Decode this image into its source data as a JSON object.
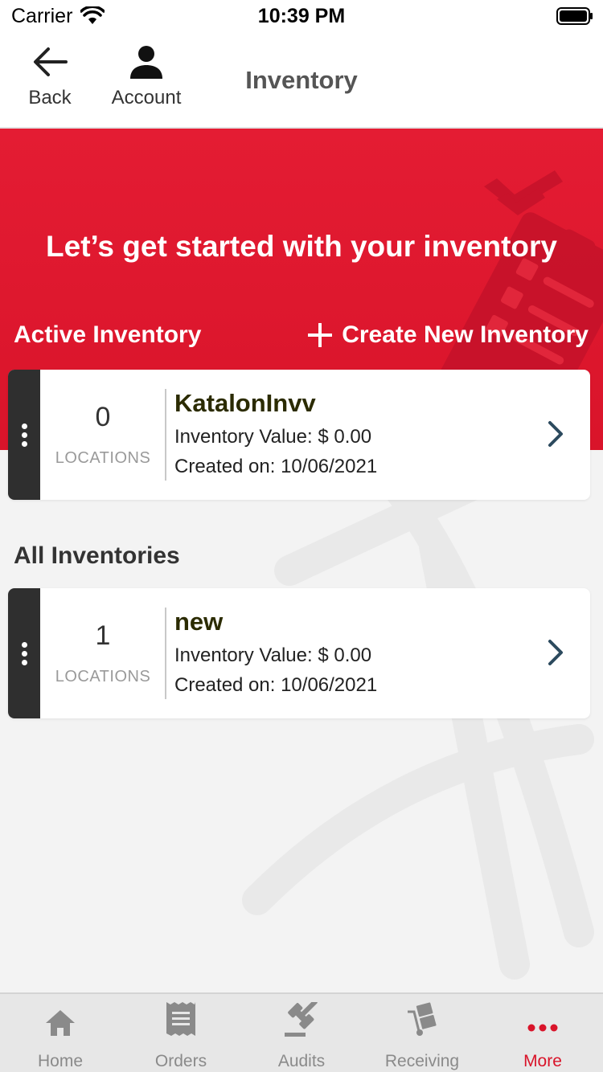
{
  "status_bar": {
    "carrier": "Carrier",
    "time": "10:39 PM"
  },
  "header": {
    "back_label": "Back",
    "account_label": "Account",
    "title": "Inventory"
  },
  "hero": {
    "title": "Let’s get started with your inventory",
    "active_section_label": "Active Inventory",
    "create_label": "Create New Inventory"
  },
  "active_inventories": [
    {
      "count": "0",
      "count_label": "LOCATIONS",
      "name": "KatalonInvv",
      "value": "Inventory Value: $ 0.00",
      "created": "Created on: 10/06/2021"
    }
  ],
  "all_section_label": "All Inventories",
  "all_inventories": [
    {
      "count": "1",
      "count_label": "LOCATIONS",
      "name": "new",
      "value": "Inventory Value: $ 0.00",
      "created": "Created on: 10/06/2021"
    }
  ],
  "tabbar": {
    "items": [
      {
        "label": "Home",
        "icon": "home-icon"
      },
      {
        "label": "Orders",
        "icon": "receipt-icon"
      },
      {
        "label": "Audits",
        "icon": "gavel-icon"
      },
      {
        "label": "Receiving",
        "icon": "hand-truck-icon"
      },
      {
        "label": "More",
        "icon": "more-dots-icon",
        "active": true
      }
    ]
  },
  "colors": {
    "brand_red": "#d9142a",
    "handle_dark": "#2f2f2f",
    "chevron": "#2c4a5e"
  }
}
